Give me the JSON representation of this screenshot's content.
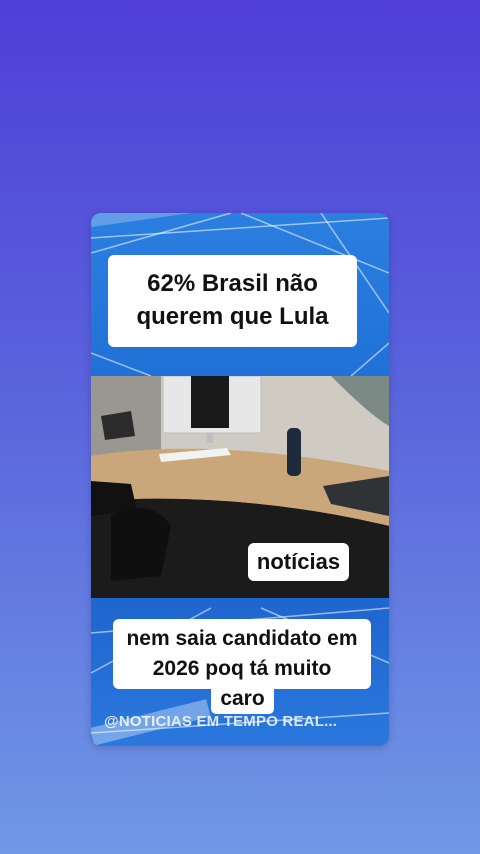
{
  "post": {
    "headline": "62% Brasil não querem que Lula",
    "tag": "notícias",
    "caption": "nem saia candidato em 2026 poq tá muito",
    "caption_tail": "caro",
    "watermark": "@NOTICIAS EM TEMPO REAL..."
  },
  "colors": {
    "background_top": "#4f3fd8",
    "background_bottom": "#6f98e6",
    "card_blue": "#1f6fd6",
    "label_background": "#ffffff",
    "label_text": "#111111"
  },
  "photo": {
    "scene": "office desk with computer monitor, keyboard and telephone"
  }
}
